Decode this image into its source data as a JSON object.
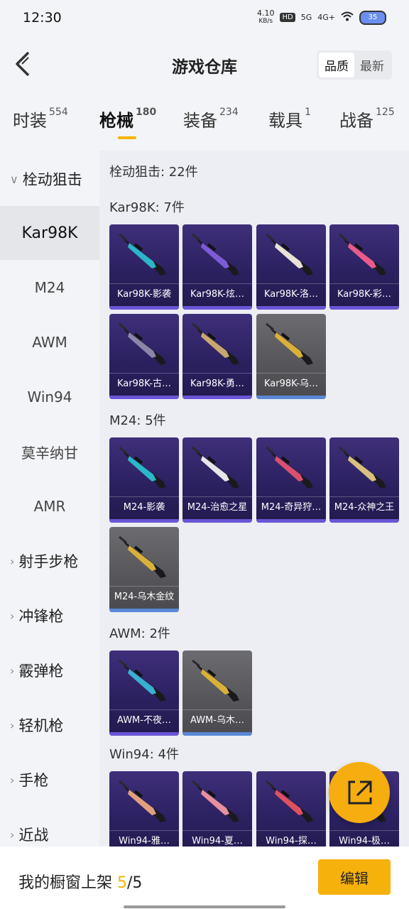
{
  "status": {
    "time": "12:30",
    "net_speed": "4.10",
    "net_unit": "KB/s",
    "hd": "HD",
    "sig1": "5G",
    "sig2": "4G+",
    "battery": "35"
  },
  "header": {
    "title": "游戏仓库",
    "sort": [
      "品质",
      "最新"
    ]
  },
  "tabs": [
    {
      "label": "时装",
      "count": "554"
    },
    {
      "label": "枪械",
      "count": "180"
    },
    {
      "label": "装备",
      "count": "234"
    },
    {
      "label": "载具",
      "count": "1"
    },
    {
      "label": "战备",
      "count": "125"
    }
  ],
  "sidebar": [
    {
      "label": "栓动狙击",
      "expanded": true
    },
    {
      "label": "Kar98K"
    },
    {
      "label": "M24"
    },
    {
      "label": "AWM"
    },
    {
      "label": "Win94"
    },
    {
      "label": "莫辛纳甘"
    },
    {
      "label": "AMR"
    },
    {
      "label": "射手步枪"
    },
    {
      "label": "冲锋枪"
    },
    {
      "label": "霰弹枪"
    },
    {
      "label": "轻机枪"
    },
    {
      "label": "手枪"
    },
    {
      "label": "近战"
    }
  ],
  "content": {
    "total": "栓动狙击: 22件",
    "sections": [
      {
        "title": "Kar98K: 7件",
        "items": [
          {
            "name": "Kar98K-影袭",
            "q": "purple",
            "c": "#2bb6c9"
          },
          {
            "name": "Kar98K-炫…",
            "q": "purple",
            "c": "#7c5bd8"
          },
          {
            "name": "Kar98K-洛…",
            "q": "purple",
            "c": "#e8e2d8"
          },
          {
            "name": "Kar98K-彩…",
            "q": "purple",
            "c": "#e85b8c"
          },
          {
            "name": "Kar98K-古…",
            "q": "purple",
            "c": "#8a86a8"
          },
          {
            "name": "Kar98K-勇…",
            "q": "purple",
            "c": "#c8a870"
          },
          {
            "name": "Kar98K-乌…",
            "q": "grey",
            "c": "#d9b13a"
          }
        ]
      },
      {
        "title": "M24: 5件",
        "items": [
          {
            "name": "M24-影袭",
            "q": "purple",
            "c": "#2bb6c9"
          },
          {
            "name": "M24-治愈之星",
            "q": "purple",
            "c": "#e6e6ea"
          },
          {
            "name": "M24-奇异狩…",
            "q": "purple",
            "c": "#d85070"
          },
          {
            "name": "M24-众神之王",
            "q": "purple",
            "c": "#d8c080"
          },
          {
            "name": "M24-乌木金纹",
            "q": "grey",
            "c": "#d9b13a"
          }
        ]
      },
      {
        "title": "AWM: 2件",
        "items": [
          {
            "name": "AWM-不夜…",
            "q": "purple",
            "c": "#3ab0d0"
          },
          {
            "name": "AWM-乌木…",
            "q": "grey",
            "c": "#d9b13a"
          }
        ]
      },
      {
        "title": "Win94: 4件",
        "items": [
          {
            "name": "Win94-雅…",
            "q": "purple",
            "c": "#e0a080"
          },
          {
            "name": "Win94-夏…",
            "q": "purple",
            "c": "#e890a0"
          },
          {
            "name": "Win94-探…",
            "q": "purple",
            "c": "#e05060"
          },
          {
            "name": "Win94-极…",
            "q": "purple",
            "c": "#c08050"
          }
        ]
      }
    ]
  },
  "footer": {
    "prefix": "我的橱窗上架 ",
    "count": "5",
    "total": "/5",
    "edit": "编辑"
  }
}
